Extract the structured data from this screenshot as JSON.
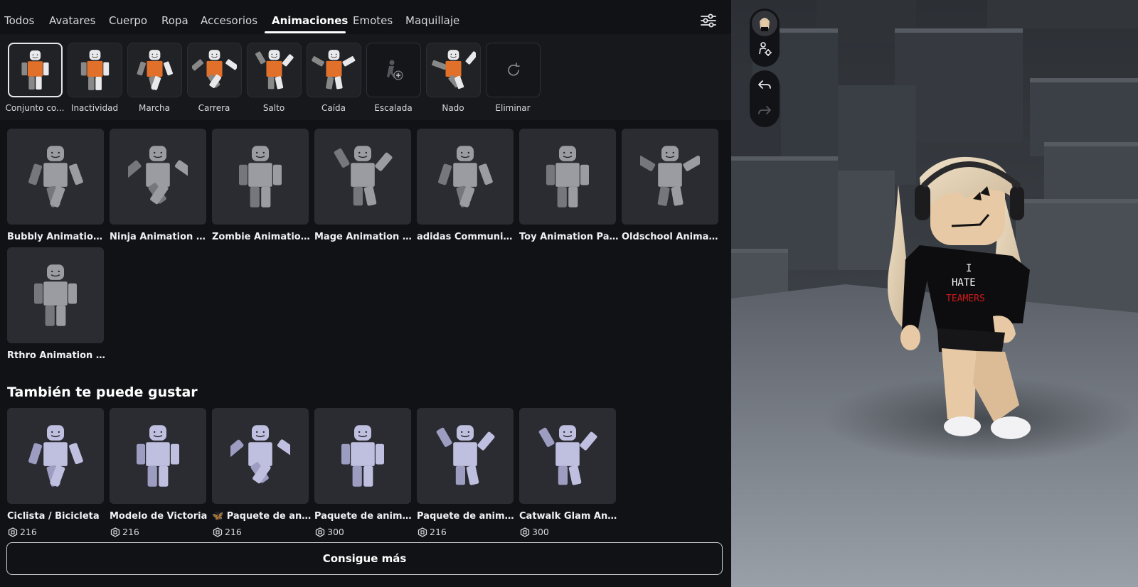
{
  "tabs": [
    {
      "label": "Todos",
      "active": false
    },
    {
      "label": "Avatares",
      "active": false
    },
    {
      "label": "Cuerpo",
      "active": false
    },
    {
      "label": "Ropa",
      "active": false
    },
    {
      "label": "Accesorios",
      "active": false
    },
    {
      "label": "Animaciones",
      "active": true
    },
    {
      "label": "Emotes",
      "active": false
    },
    {
      "label": "Maquillaje",
      "active": false
    }
  ],
  "slots": [
    {
      "label": "Conjunto co...",
      "selected": true,
      "pose": "idle"
    },
    {
      "label": "Inactividad",
      "pose": "idle"
    },
    {
      "label": "Marcha",
      "pose": "walk"
    },
    {
      "label": "Carrera",
      "pose": "run"
    },
    {
      "label": "Salto",
      "pose": "jump"
    },
    {
      "label": "Caída",
      "pose": "fall"
    },
    {
      "label": "Escalada",
      "empty": true,
      "icon": "climb-add-icon"
    },
    {
      "label": "Nado",
      "pose": "swim"
    },
    {
      "label": "Eliminar",
      "empty": true,
      "icon": "reset-icon"
    }
  ],
  "owned": [
    {
      "label": "Bubbly Animation P...",
      "pose": "walk"
    },
    {
      "label": "Ninja Animation Pa...",
      "pose": "run"
    },
    {
      "label": "Zombie Animation ...",
      "pose": "idle"
    },
    {
      "label": "Mage Animation Pa...",
      "pose": "jump"
    },
    {
      "label": "adidas Community ...",
      "pose": "walk"
    },
    {
      "label": "Toy Animation Pack",
      "pose": "idle"
    },
    {
      "label": "Oldschool Animatio...",
      "pose": "fall"
    },
    {
      "label": "Rthro Animation Pa...",
      "pose": "idle"
    }
  ],
  "recommend": {
    "title": "También te puede gustar",
    "items": [
      {
        "label": "Ciclista / Bicicleta",
        "price": "216",
        "pose": "walk"
      },
      {
        "label": "Modelo de Victoria",
        "price": "216",
        "pose": "idle"
      },
      {
        "label": "🦋 Paquete de anim...",
        "price": "216",
        "pose": "run"
      },
      {
        "label": "Paquete de animaci...",
        "price": "300",
        "pose": "idle"
      },
      {
        "label": "Paquete de animaci...",
        "price": "216",
        "pose": "jump"
      },
      {
        "label": "Catwalk Glam Anim...",
        "price": "300",
        "pose": "jump"
      }
    ]
  },
  "more_button": "Consigue más",
  "shirt_text": {
    "line1": "I",
    "line2": "HATE",
    "line3": "TEAMERS"
  },
  "colors": {
    "bg": "#111216",
    "card": "#2a2c31",
    "figure_gray": "#9a9ca1",
    "figure_lavender": "#bfbfe0",
    "figure_orange": "#e0702a"
  }
}
